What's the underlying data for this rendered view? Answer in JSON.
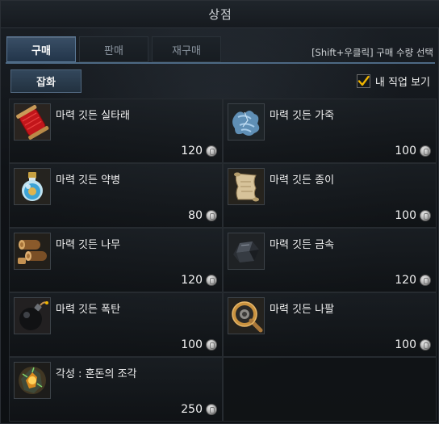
{
  "window": {
    "title": "상점"
  },
  "tabs": [
    {
      "label": "구매",
      "active": true
    },
    {
      "label": "판매",
      "active": false
    },
    {
      "label": "재구매",
      "active": false
    }
  ],
  "hint": "[Shift+우클릭] 구매 수량 선택",
  "category": {
    "label": "잡화"
  },
  "filter": {
    "label": "내 직업 보기",
    "checked": true
  },
  "items": [
    {
      "name": "마력 깃든 실타래",
      "price": "120",
      "icon": "thread-spool-icon"
    },
    {
      "name": "마력 깃든 가죽",
      "price": "100",
      "icon": "leather-icon"
    },
    {
      "name": "마력 깃든 약병",
      "price": "80",
      "icon": "potion-bottle-icon"
    },
    {
      "name": "마력 깃든 종이",
      "price": "100",
      "icon": "paper-scroll-icon"
    },
    {
      "name": "마력 깃든 나무",
      "price": "120",
      "icon": "wood-log-icon"
    },
    {
      "name": "마력 깃든 금속",
      "price": "120",
      "icon": "metal-ore-icon"
    },
    {
      "name": "마력 깃든 폭탄",
      "price": "100",
      "icon": "bomb-icon"
    },
    {
      "name": "마력 깃든 나팔",
      "price": "100",
      "icon": "horn-icon"
    },
    {
      "name": "각성 : 혼돈의 조각",
      "price": "250",
      "icon": "chaos-shard-icon"
    }
  ],
  "colors": {
    "accent": "#4d6984",
    "checkmark": "#f0b400"
  }
}
